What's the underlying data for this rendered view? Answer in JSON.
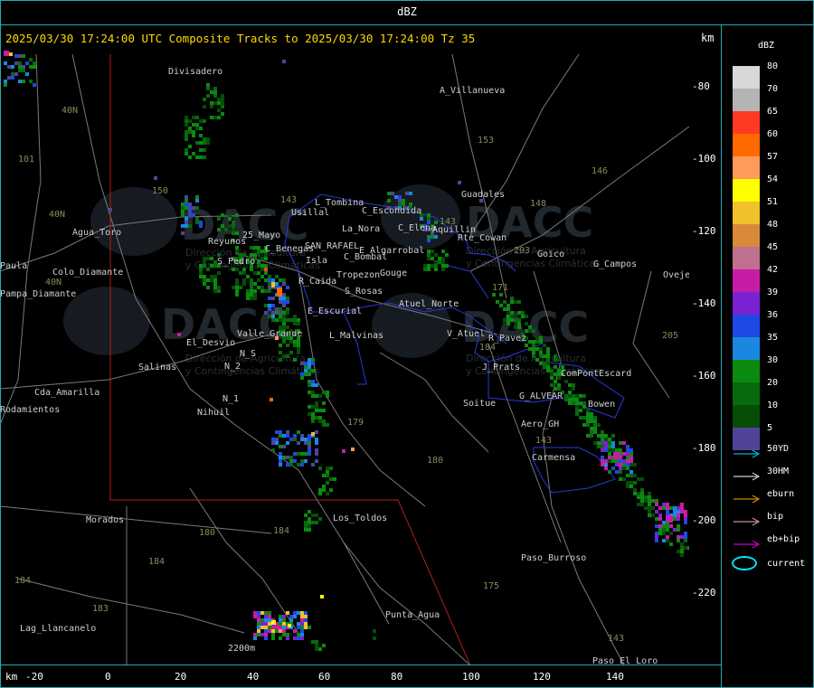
{
  "window": {
    "title": "dBZ"
  },
  "header": {
    "text": "2025/03/30 17:24:00 UTC Composite Tracks to 2025/03/30 17:24:00 Tz 35",
    "unit_label": "km"
  },
  "x_axis": {
    "unit_label": "km",
    "ticks": [
      "-20",
      "0",
      "20",
      "40",
      "60",
      "80",
      "100",
      "120",
      "140"
    ]
  },
  "y_axis": {
    "ticks": [
      "-80",
      "-100",
      "-120",
      "-140",
      "-160",
      "-180",
      "-200",
      "-220"
    ]
  },
  "legend": {
    "title": "dBZ",
    "levels": [
      {
        "label": "80",
        "color": "#d8d8d8"
      },
      {
        "label": "70",
        "color": "#b4b4b4"
      },
      {
        "label": "65",
        "color": "#ff3a24"
      },
      {
        "label": "60",
        "color": "#ff6a00"
      },
      {
        "label": "57",
        "color": "#ff9a5a"
      },
      {
        "label": "54",
        "color": "#ffff00"
      },
      {
        "label": "51",
        "color": "#f2c02a"
      },
      {
        "label": "48",
        "color": "#d88a3a"
      },
      {
        "label": "45",
        "color": "#c0708e"
      },
      {
        "label": "42",
        "color": "#c81ca8"
      },
      {
        "label": "39",
        "color": "#7a22d2"
      },
      {
        "label": "36",
        "color": "#1f48e6"
      },
      {
        "label": "35",
        "color": "#1a88e0"
      },
      {
        "label": "30",
        "color": "#0a8a10"
      },
      {
        "label": "20",
        "color": "#076a0c"
      },
      {
        "label": "10",
        "color": "#064d08"
      },
      {
        "label": "5",
        "color": "#50449a"
      }
    ],
    "tracks": [
      {
        "label": "50YD",
        "color": "#00e5ff"
      },
      {
        "label": "30HM",
        "color": "#ffffff"
      },
      {
        "label": "eburn",
        "color": "#ffb000"
      },
      {
        "label": "bip",
        "color": "#ffb0c8"
      },
      {
        "label": "eb+bip",
        "color": "#ff00ff"
      }
    ],
    "current_label": "current"
  },
  "map": {
    "places": [
      "Divisadero",
      "A_Villanueva",
      "Guadales",
      "L_Tombina",
      "Usillal",
      "C_Escondida",
      "La_Nora",
      "C_Bombal",
      "C_Elena",
      "Aquillin",
      "Rte_Cowan",
      "Reyunos",
      "25_Mayo",
      "C_Benegas",
      "SAN_RAFAEL",
      "E_Algarrobal",
      "Goico",
      "G_Campos",
      "Ovejeria",
      "S_Pedro",
      "Isla",
      "Tropezon",
      "Gouge",
      "R_Caida",
      "S_Rosas",
      "Atuel_Norte",
      "E_Escurial",
      "Valle_Grande",
      "L_Malvinas",
      "V_Atuel",
      "R_Pavez",
      "El_Desvio",
      "Salinas",
      "N_S",
      "N_2",
      "J_Prats",
      "ComPontEscard",
      "G_ALVEAR",
      "Bowen",
      "N_1",
      "Nihuil",
      "Soitue",
      "Aero_GH",
      "Carmensa",
      "Agua_Toro",
      "Colo_Diamante",
      "Paula",
      "Pampa_Diamante",
      "Cda_Amarilla",
      "Rodamientos",
      "Los_Toldos",
      "Morados",
      "Paso_Burroso",
      "Punta_Agua",
      "Lag_Llancanelo",
      "Paso_El_Loro",
      "2200m"
    ],
    "routes": [
      "40N",
      "101",
      "40N",
      "40N",
      "150",
      "143",
      "153",
      "146",
      "148",
      "143",
      "203",
      "171",
      "184",
      "205",
      "179",
      "180",
      "184",
      "184",
      "183",
      "184",
      "180",
      "175",
      "143",
      "143"
    ],
    "watermark": {
      "brand": "DACC",
      "sub1": "Dirección de Agricultura",
      "sub2": "y Contingencias Climáticas"
    }
  }
}
